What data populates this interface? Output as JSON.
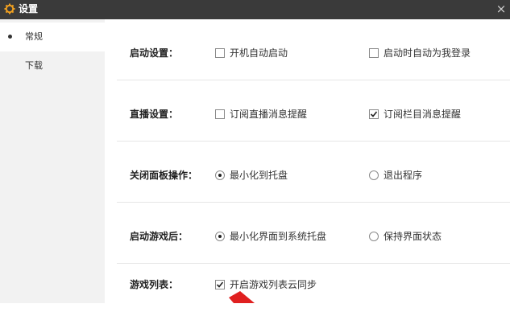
{
  "window": {
    "title": "设置",
    "icon": "gear-icon",
    "close_glyph": "×"
  },
  "sidebar": {
    "items": [
      {
        "label": "常规",
        "active": true
      },
      {
        "label": "下载",
        "active": false
      }
    ]
  },
  "settings": [
    {
      "label": "启动设置：",
      "options": [
        {
          "type": "checkbox",
          "text": "开机自动启动",
          "checked": false
        },
        {
          "type": "checkbox",
          "text": "启动时自动为我登录",
          "checked": false
        }
      ]
    },
    {
      "label": "直播设置：",
      "options": [
        {
          "type": "checkbox",
          "text": "订阅直播消息提醒",
          "checked": false
        },
        {
          "type": "checkbox",
          "text": "订阅栏目消息提醒",
          "checked": true
        }
      ]
    },
    {
      "label": "关闭面板操作：",
      "options": [
        {
          "type": "radio",
          "text": "最小化到托盘",
          "checked": true
        },
        {
          "type": "radio",
          "text": "退出程序",
          "checked": false
        }
      ]
    },
    {
      "label": "启动游戏后：",
      "options": [
        {
          "type": "radio",
          "text": "最小化界面到系统托盘",
          "checked": true
        },
        {
          "type": "radio",
          "text": "保持界面状态",
          "checked": false
        }
      ]
    },
    {
      "label": "游戏列表：",
      "options": [
        {
          "type": "checkbox",
          "text": "开启游戏列表云同步",
          "checked": true
        }
      ]
    }
  ],
  "colors": {
    "titlebar": "#3a3a3a",
    "gear": "#f0a020",
    "annotation_arrow": "#e02020"
  }
}
